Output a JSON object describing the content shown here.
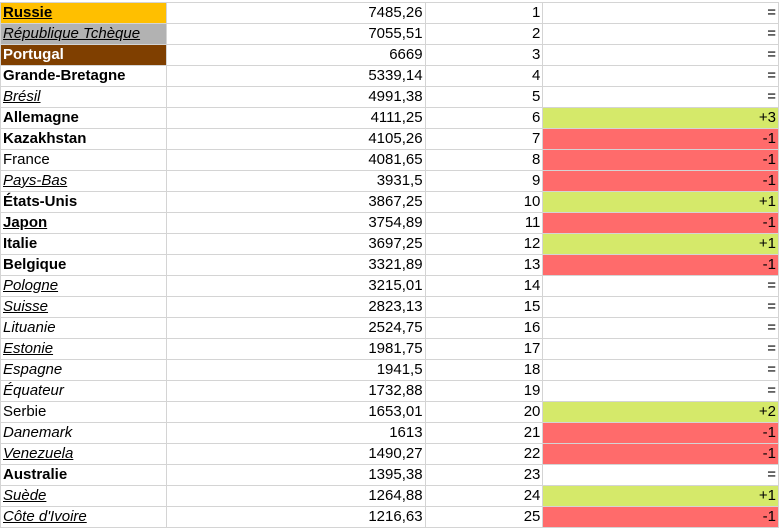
{
  "colors": {
    "up": "#d5e96a",
    "down": "#ff6b6b"
  },
  "rows": [
    {
      "country": "Russie",
      "score": "7485,26",
      "rank": "1",
      "change": "=",
      "style": [
        "bold",
        "underline"
      ],
      "fill": "#ffbf00",
      "text_color": "#000000"
    },
    {
      "country": "République Tchèque",
      "score": "7055,51",
      "rank": "2",
      "change": "=",
      "style": [
        "italic",
        "underline"
      ],
      "fill": "#b2b2b2",
      "text_color": "#000000"
    },
    {
      "country": "Portugal",
      "score": "6669",
      "rank": "3",
      "change": "=",
      "style": [
        "bold"
      ],
      "fill": "#7f3f00",
      "text_color": "#ffffff"
    },
    {
      "country": "Grande-Bretagne",
      "score": "5339,14",
      "rank": "4",
      "change": "=",
      "style": [
        "bold"
      ]
    },
    {
      "country": "Brésil",
      "score": "4991,38",
      "rank": "5",
      "change": "=",
      "style": [
        "italic",
        "underline"
      ]
    },
    {
      "country": "Allemagne",
      "score": "4111,25",
      "rank": "6",
      "change": "+3",
      "style": [
        "bold"
      ],
      "trend": "up"
    },
    {
      "country": "Kazakhstan",
      "score": "4105,26",
      "rank": "7",
      "change": "-1",
      "style": [
        "bold"
      ],
      "trend": "down"
    },
    {
      "country": "France",
      "score": "4081,65",
      "rank": "8",
      "change": "-1",
      "style": [],
      "trend": "down"
    },
    {
      "country": "Pays-Bas",
      "score": "3931,5",
      "rank": "9",
      "change": "-1",
      "style": [
        "italic",
        "underline"
      ],
      "trend": "down"
    },
    {
      "country": "États-Unis",
      "score": "3867,25",
      "rank": "10",
      "change": "+1",
      "style": [
        "bold"
      ],
      "trend": "up"
    },
    {
      "country": "Japon",
      "score": "3754,89",
      "rank": "11",
      "change": "-1",
      "style": [
        "bold",
        "underline"
      ],
      "trend": "down"
    },
    {
      "country": "Italie",
      "score": "3697,25",
      "rank": "12",
      "change": "+1",
      "style": [
        "bold"
      ],
      "trend": "up"
    },
    {
      "country": "Belgique",
      "score": "3321,89",
      "rank": "13",
      "change": "-1",
      "style": [
        "bold"
      ],
      "trend": "down"
    },
    {
      "country": "Pologne",
      "score": "3215,01",
      "rank": "14",
      "change": "=",
      "style": [
        "italic",
        "underline"
      ]
    },
    {
      "country": "Suisse",
      "score": "2823,13",
      "rank": "15",
      "change": "=",
      "style": [
        "italic",
        "underline"
      ]
    },
    {
      "country": "Lituanie",
      "score": "2524,75",
      "rank": "16",
      "change": "=",
      "style": [
        "italic"
      ]
    },
    {
      "country": "Estonie",
      "score": "1981,75",
      "rank": "17",
      "change": "=",
      "style": [
        "italic",
        "underline"
      ]
    },
    {
      "country": "Espagne",
      "score": "1941,5",
      "rank": "18",
      "change": "=",
      "style": [
        "italic"
      ]
    },
    {
      "country": "Équateur",
      "score": "1732,88",
      "rank": "19",
      "change": "=",
      "style": [
        "italic"
      ]
    },
    {
      "country": "Serbie",
      "score": "1653,01",
      "rank": "20",
      "change": "+2",
      "style": [],
      "trend": "up"
    },
    {
      "country": "Danemark",
      "score": "1613",
      "rank": "21",
      "change": "-1",
      "style": [
        "italic"
      ],
      "trend": "down"
    },
    {
      "country": "Venezuela",
      "score": "1490,27",
      "rank": "22",
      "change": "-1",
      "style": [
        "italic",
        "underline"
      ],
      "trend": "down"
    },
    {
      "country": "Australie",
      "score": "1395,38",
      "rank": "23",
      "change": "=",
      "style": [
        "bold"
      ]
    },
    {
      "country": "Suède",
      "score": "1264,88",
      "rank": "24",
      "change": "+1",
      "style": [
        "italic",
        "underline"
      ],
      "trend": "up"
    },
    {
      "country": "Côte d'Ivoire",
      "score": "1216,63",
      "rank": "25",
      "change": "-1",
      "style": [
        "italic",
        "underline"
      ],
      "trend": "down"
    }
  ]
}
